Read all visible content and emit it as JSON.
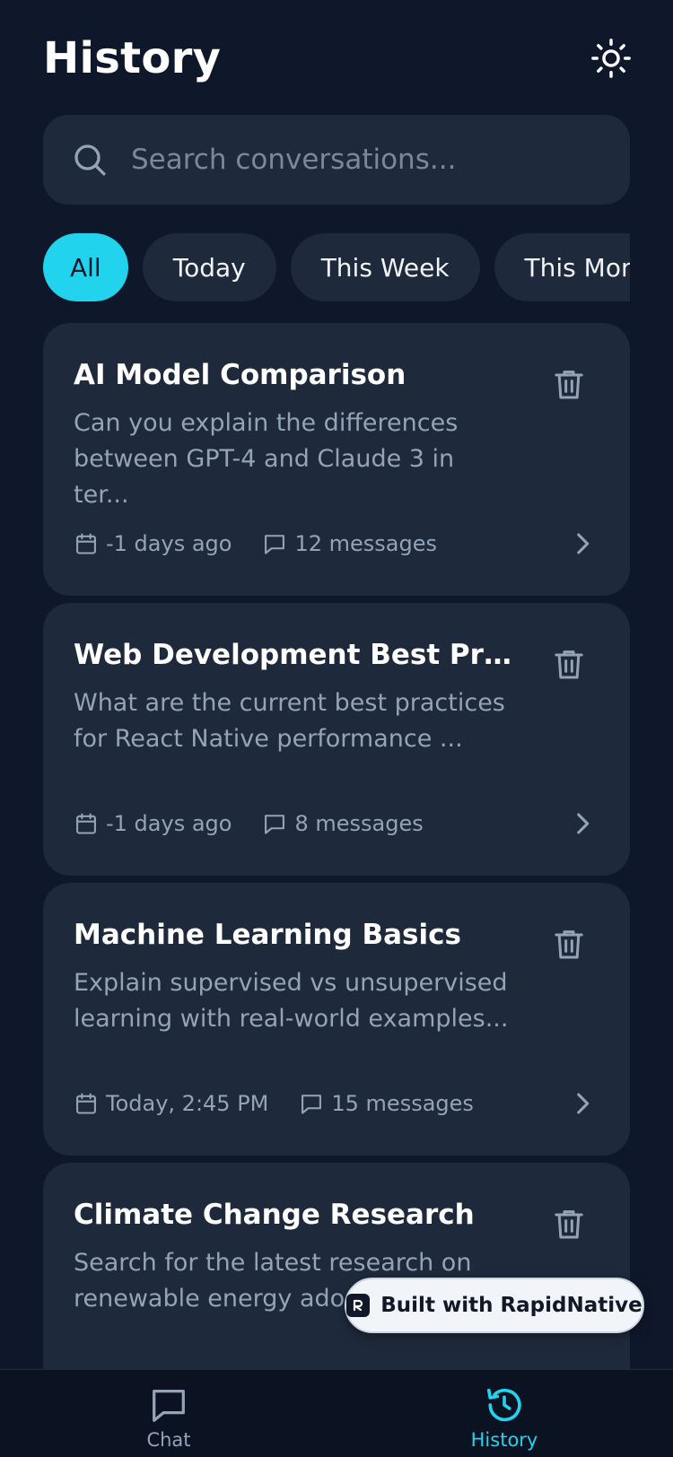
{
  "header": {
    "title": "History",
    "theme_icon": "sun-icon"
  },
  "search": {
    "placeholder": "Search conversations..."
  },
  "filters": [
    {
      "label": "All",
      "active": true
    },
    {
      "label": "Today",
      "active": false
    },
    {
      "label": "This Week",
      "active": false
    },
    {
      "label": "This Month",
      "active": false
    }
  ],
  "conversations": [
    {
      "title": "AI Model Comparison",
      "preview": "Can you explain the differences between GPT-4 and Claude 3 in ter...",
      "date": "-1 days ago",
      "messages": "12 messages"
    },
    {
      "title": "Web Development Best Practices",
      "preview": "What are the current best practices for React Native performance ...",
      "date": "-1 days ago",
      "messages": "8 messages"
    },
    {
      "title": "Machine Learning Basics",
      "preview": "Explain supervised vs unsupervised learning with real-world examples...",
      "date": "Today, 2:45 PM",
      "messages": "15 messages"
    },
    {
      "title": "Climate Change Research",
      "preview": "Search for the latest research on renewable energy adoption",
      "date": "",
      "messages": ""
    }
  ],
  "badge": {
    "label": "Built with RapidNative"
  },
  "tabs": [
    {
      "label": "Chat",
      "icon": "chat-bubble-icon",
      "active": false
    },
    {
      "label": "History",
      "icon": "history-icon",
      "active": true
    }
  ],
  "colors": {
    "background": "#0f172a",
    "card": "#1e293b",
    "accent": "#22d3ee",
    "muted": "#94a3b8"
  }
}
